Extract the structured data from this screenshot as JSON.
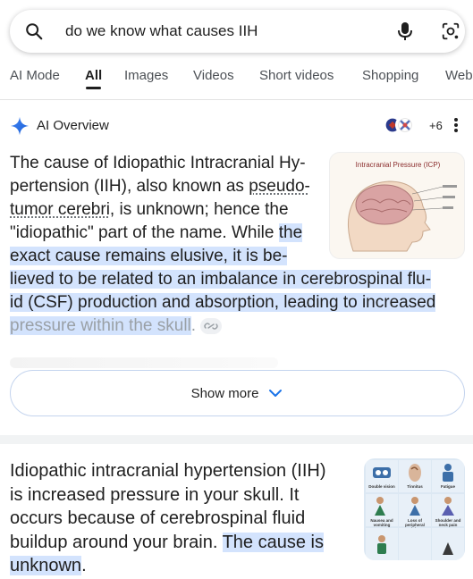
{
  "search": {
    "query": "do we know what causes IIH",
    "icons": [
      "search-icon",
      "mic-icon",
      "lens-icon"
    ]
  },
  "tabs": [
    "AI Mode",
    "All",
    "Images",
    "Videos",
    "Short videos",
    "Shopping",
    "Web"
  ],
  "active_tab": "All",
  "ai_overview": {
    "title": "AI Overview",
    "sources_more": "+6",
    "text_plain_1": "The cause of Idiopathic Intracranial Hy-",
    "text_plain_2": "pertension (IIH), also known as ",
    "text_link": "pseudo-",
    "text_link_2": "tumor cerebri",
    "text_plain_3": ", is unknown; hence the",
    "text_plain_4": "\"idiopathic\" part of the name. While ",
    "hl_1": "the",
    "hl_2": "exact cause remains elusive, it is be-",
    "hl_3": "lieved to be related to an imbalance in cerebrospinal flu-",
    "hl_4": "id (CSF) production and absorption, leading to increased",
    "hl_5": "pressure within the skull",
    "text_end": ".",
    "image_title": "Intracranial Pressure (ICP)",
    "show_more": "Show more"
  },
  "result": {
    "text_1": "Idiopathic intracranial hypertension (IIH)",
    "text_2": "is increased pressure in your skull. It",
    "text_3": "occurs because of cerebrospinal fluid",
    "text_4": "buildup around your brain. ",
    "hl_1": "The cause is",
    "hl_2": "unknown",
    "text_end": ".",
    "image_captions": [
      "Double vision",
      "Tinnitus",
      "Fatigue",
      "Nausea and vomiting",
      "Loss of peripheral vision",
      "Shoulder and neck pain"
    ]
  },
  "colors": {
    "highlight": "#d3e3fd",
    "accent_blue": "#1a73e8",
    "text": "#1f1f1f"
  }
}
